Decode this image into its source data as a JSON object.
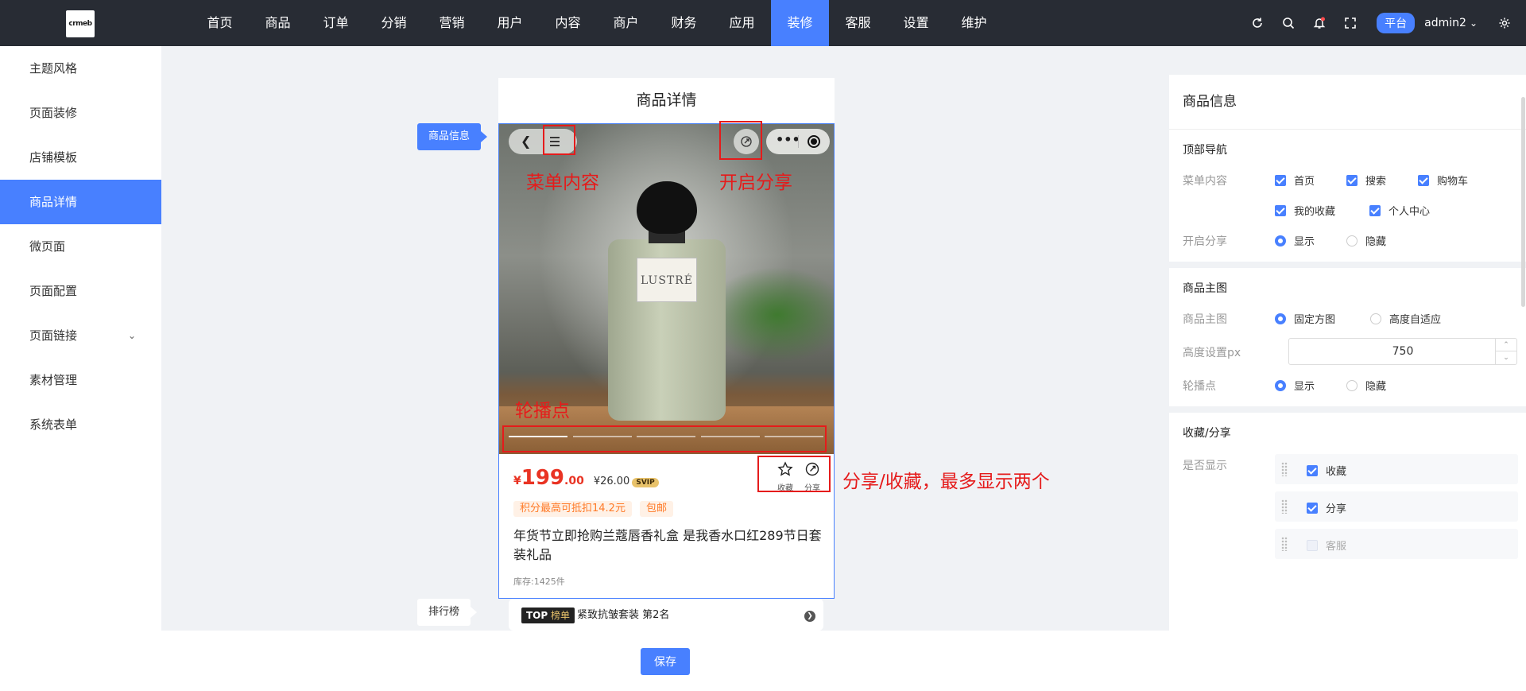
{
  "topbar": {
    "logo_text": "crmeb",
    "nav": [
      "首页",
      "商品",
      "订单",
      "分销",
      "营销",
      "用户",
      "内容",
      "商户",
      "财务",
      "应用",
      "装修",
      "客服",
      "设置",
      "维护"
    ],
    "active_nav": "装修",
    "platform_label": "平台",
    "admin_name": "admin2",
    "accent_color": "#4880ff"
  },
  "sidebar": {
    "items": [
      "主题风格",
      "页面装修",
      "店铺模板",
      "商品详情",
      "微页面",
      "页面配置",
      "页面链接",
      "素材管理",
      "系统表单"
    ],
    "active": "商品详情"
  },
  "preview": {
    "page_title": "商品详情",
    "label_goods": "商品信息",
    "label_rank": "排行榜",
    "bottle_brand": "LUSTRÉ",
    "price_symbol": "¥",
    "price_int": "199",
    "price_dec": ".00",
    "vip_price": "¥26.00",
    "svip_label": "SVIP",
    "fav_label": "收藏",
    "share_label": "分享",
    "tags": [
      "积分最高可抵扣14.2元",
      "包邮"
    ],
    "goods_name": "年货节立即抢购兰蔻唇香礼盒 是我香水口红289节日套装礼品",
    "stock": "库存:1425件",
    "rank_badge_top": "TOP",
    "rank_badge_list": "榜单",
    "rank_text": "紧致抗皱套装 第2名"
  },
  "annotations": {
    "menu_content": "菜单内容",
    "enable_share": "开启分享",
    "carousel_dots": "轮播点",
    "share_fav": "分享/收藏，最多显示两个",
    "color": "#e51b1b"
  },
  "panel": {
    "title": "商品信息",
    "top_nav": {
      "heading": "顶部导航",
      "menu_label": "菜单内容",
      "menu_options": [
        "首页",
        "搜索",
        "购物车",
        "我的收藏",
        "个人中心"
      ],
      "share_label": "开启分享",
      "share_options": [
        "显示",
        "隐藏"
      ],
      "share_selected": "显示"
    },
    "main_image": {
      "heading": "商品主图",
      "image_label": "商品主图",
      "image_options": [
        "固定方图",
        "高度自适应"
      ],
      "image_selected": "固定方图",
      "height_label": "高度设置px",
      "height_value": "750",
      "dots_label": "轮播点",
      "dots_options": [
        "显示",
        "隐藏"
      ],
      "dots_selected": "显示"
    },
    "fav_share": {
      "heading": "收藏/分享",
      "show_label": "是否显示",
      "items": [
        {
          "label": "收藏",
          "checked": true
        },
        {
          "label": "分享",
          "checked": true
        },
        {
          "label": "客服",
          "checked": false
        }
      ]
    }
  },
  "footer": {
    "save_label": "保存"
  }
}
